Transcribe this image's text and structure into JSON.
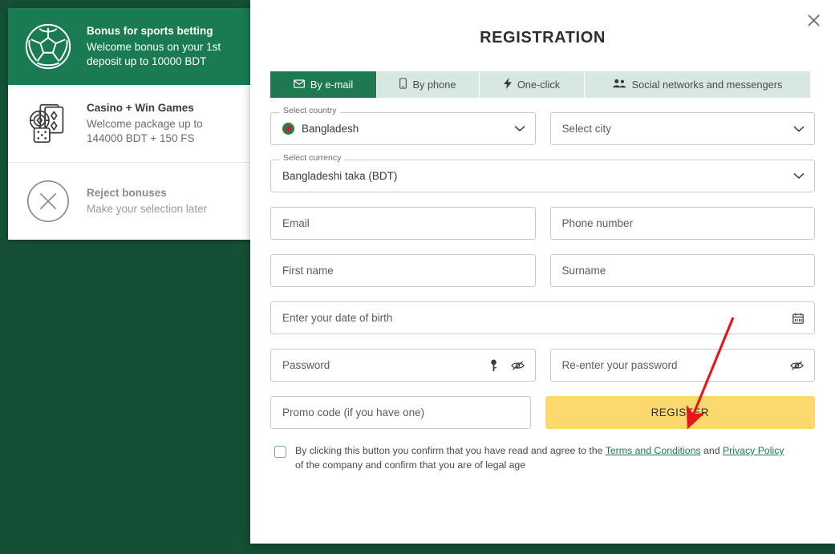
{
  "bonus_panel": {
    "cards": [
      {
        "icon": "soccer-ball-icon",
        "title": "Bonus for sports betting",
        "subtitle": "Welcome bonus on your 1st deposit up to 10000 BDT",
        "state": "active"
      },
      {
        "icon": "casino-cards-chip-dice-icon",
        "title": "Casino + Win Games",
        "subtitle": "Welcome package up to 144000 BDT + 150 FS",
        "state": "default"
      },
      {
        "icon": "circle-x-icon",
        "title": "Reject bonuses",
        "subtitle": "Make your selection later",
        "state": "muted"
      }
    ]
  },
  "modal": {
    "title": "REGISTRATION",
    "close_label": "✕",
    "tabs": [
      {
        "label": "By e-mail",
        "icon": "envelope-icon",
        "active": true
      },
      {
        "label": "By phone",
        "icon": "mobile-phone-icon",
        "active": false
      },
      {
        "label": "One-click",
        "icon": "lightning-bolt-icon",
        "active": false
      },
      {
        "label": "Social networks and messengers",
        "icon": "people-group-icon",
        "active": false
      }
    ],
    "country": {
      "legend": "Select country",
      "value": "Bangladesh",
      "flag": "bangladesh-flag-icon"
    },
    "city": {
      "placeholder": "Select city"
    },
    "currency": {
      "legend": "Select currency",
      "value": "Bangladeshi taka (BDT)"
    },
    "fields": {
      "email_placeholder": "Email",
      "phone_placeholder": "Phone number",
      "first_name_placeholder": "First name",
      "surname_placeholder": "Surname",
      "dob_placeholder": "Enter your date of birth",
      "password_placeholder": "Password",
      "repeat_password_placeholder": "Re-enter your password",
      "promo_placeholder": "Promo code (if you have one)"
    },
    "register_button": "REGISTER",
    "consent": {
      "text_before": "By clicking this button you confirm that you have read and agree to the ",
      "link_terms": "Terms and Conditions",
      "text_middle": " and ",
      "link_privacy": "Privacy Policy",
      "text_after": " of the company and confirm that you are of legal age"
    }
  },
  "colors": {
    "page_background": "#154f36",
    "bonus_active": "#1a7a52",
    "tab_active": "#1e7850",
    "tab_inactive": "#d7e8e0",
    "register_button": "#fcd96e",
    "link": "#1e7850",
    "annotation_arrow": "#e8151b"
  }
}
